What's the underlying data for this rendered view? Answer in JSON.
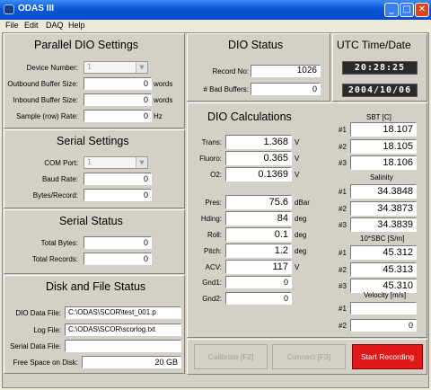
{
  "window": {
    "title": "ODAS III"
  },
  "menu": [
    "File",
    "Edit",
    "DAQ",
    "Help"
  ],
  "parallel": {
    "title": "Parallel DIO Settings",
    "device_label": "Device Number:",
    "device_value": "1",
    "outbound_label": "Outbound Buffer Size:",
    "outbound_value": "0",
    "outbound_unit": "words",
    "inbound_label": "Inbound Buffer Size:",
    "inbound_value": "0",
    "inbound_unit": "words",
    "rate_label": "Sample (row) Rate:",
    "rate_value": "0",
    "rate_unit": "Hz"
  },
  "serial_settings": {
    "title": "Serial Settings",
    "com_label": "COM Port:",
    "com_value": "1",
    "baud_label": "Baud Rate:",
    "baud_value": "0",
    "bytes_label": "Bytes/Record:",
    "bytes_value": "0"
  },
  "serial_status": {
    "title": "Serial Status",
    "total_bytes_label": "Total Bytes:",
    "total_bytes_value": "0",
    "total_records_label": "Total Records:",
    "total_records_value": "0"
  },
  "disk": {
    "title": "Disk and File Status",
    "dio_label": "DIO Data File:",
    "dio_value": "C:\\ODAS\\SCOR\\test_001.p",
    "log_label": "Log File:",
    "log_value": "C:\\ODAS\\SCOR\\scorlog.txt",
    "serial_label": "Serial Data File:",
    "serial_value": "",
    "free_label": "Free Space on Disk:",
    "free_value": "20 GB"
  },
  "dio_status": {
    "title": "DIO Status",
    "record_label": "Record No:",
    "record_value": "1026",
    "bad_label": "# Bad Buffers:",
    "bad_value": "0"
  },
  "utc": {
    "title": "UTC Time/Date",
    "time": "20:28:25",
    "date": "2004/10/06"
  },
  "calc": {
    "title": "DIO Calculations",
    "rows_top": [
      {
        "label": "Trans:",
        "value": "1.368",
        "unit": "V"
      },
      {
        "label": "Fluoro:",
        "value": "0.365",
        "unit": "V"
      },
      {
        "label": "O2:",
        "value": "0.1369",
        "unit": "V"
      }
    ],
    "rows_bottom": [
      {
        "label": "Pres:",
        "value": "75.6",
        "unit": "dBar"
      },
      {
        "label": "Hding:",
        "value": "84",
        "unit": "deg"
      },
      {
        "label": "Roll:",
        "value": "0.1",
        "unit": "deg"
      },
      {
        "label": "Pitch:",
        "value": "1.2",
        "unit": "deg"
      },
      {
        "label": "ACV:",
        "value": "117",
        "unit": "V"
      },
      {
        "label": "Gnd1:",
        "value": "0",
        "unit": ""
      },
      {
        "label": "Gnd2:",
        "value": "0",
        "unit": ""
      }
    ],
    "sbt": {
      "title": "SBT [C]",
      "values": [
        "18.107",
        "18.105",
        "18.106"
      ]
    },
    "salinity": {
      "title": "Salinity",
      "values": [
        "34.3848",
        "34.3873",
        "34.3839"
      ]
    },
    "sbc": {
      "title": "10*SBC [S/m]",
      "values": [
        "45.312",
        "45.313",
        "45.310"
      ]
    },
    "velocity": {
      "title": "Velocity [m/s]",
      "values": [
        "",
        "0"
      ]
    },
    "idx": [
      "#1",
      "#2",
      "#3"
    ]
  },
  "buttons": {
    "calibrate": "Calibrate [F2]",
    "connect": "Connect [F3]",
    "record": "Start Recording"
  },
  "colors": {
    "title_bar": "#0a55d8",
    "record_button": "#e01818"
  }
}
